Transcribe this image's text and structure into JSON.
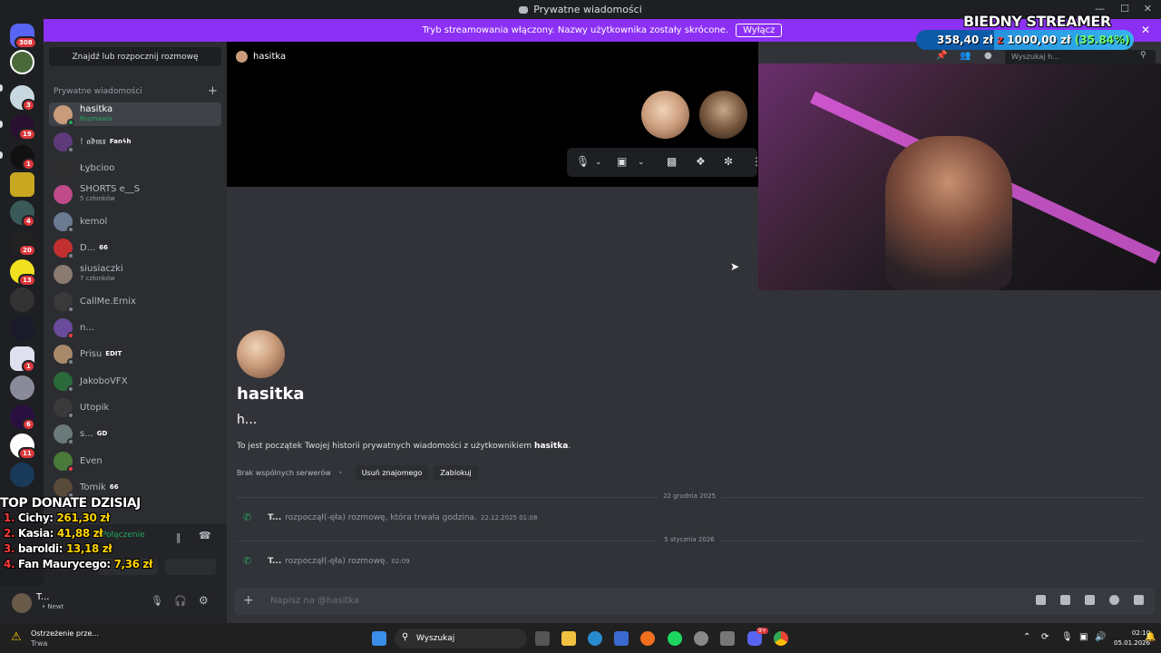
{
  "window": {
    "title": "Prywatne wiadomości"
  },
  "banner": {
    "text": "Tryb streamowania włączony. Nazwy użytkownika zostały skrócone.",
    "button": "Wyłącz"
  },
  "rail": {
    "badges": [
      "308",
      "3",
      "19",
      "1",
      "4",
      "20",
      "13",
      "1",
      "1",
      "6",
      "11"
    ]
  },
  "sidebar": {
    "find": "Znajdź lub rozpocznij rozmowę",
    "header": "Prywatne wiadomości",
    "dms": [
      {
        "name": "hasitka",
        "sub": "Rozmawia",
        "tag": "",
        "color": "#c99b7a",
        "status": "#23a55a"
      },
      {
        "name": "! 𝖆𝖉𝖒𝖝",
        "sub": "",
        "tag": "Fanϟh",
        "color": "#5e3a7a",
        "status": "#80848e"
      },
      {
        "name": "Łỵbcioo",
        "sub": "",
        "tag": "",
        "color": "#2d2d2d",
        "status": ""
      },
      {
        "name": "SHORTS e__S",
        "sub": "5 członków",
        "tag": "",
        "color": "#c04a8a",
        "status": ""
      },
      {
        "name": "kemol",
        "sub": "",
        "tag": "",
        "color": "#6a7a90",
        "status": "#80848e"
      },
      {
        "name": "D...",
        "sub": "",
        "tag": "66",
        "color": "#c23030",
        "status": "#80848e"
      },
      {
        "name": "siusiaczki",
        "sub": "7 członków",
        "tag": "",
        "color": "#8a7a70",
        "status": ""
      },
      {
        "name": "CallMe.Ernix",
        "sub": "",
        "tag": "",
        "color": "#3a3a3a",
        "status": "#80848e"
      },
      {
        "name": "n...",
        "sub": "",
        "tag": "",
        "color": "#6a4a9a",
        "status": "#f23f43"
      },
      {
        "name": "Prisu",
        "sub": "",
        "tag": "EDIT",
        "color": "#a88a6a",
        "status": "#80848e"
      },
      {
        "name": "JakoboVFX",
        "sub": "",
        "tag": "",
        "color": "#2a6a3a",
        "status": "#80848e"
      },
      {
        "name": "Utopik",
        "sub": "",
        "tag": "",
        "color": "#3a3a3a",
        "status": "#80848e"
      },
      {
        "name": "s...",
        "sub": "",
        "tag": "GD",
        "color": "#6a7a7a",
        "status": "#80848e"
      },
      {
        "name": "Even",
        "sub": "",
        "tag": "",
        "color": "#4a7a3a",
        "status": "#f23f43"
      },
      {
        "name": "Tomik",
        "sub": "",
        "tag": "66",
        "color": "#5a4a3a",
        "status": "#80848e"
      }
    ]
  },
  "voice": {
    "status": "Połączenie"
  },
  "user": {
    "name": "T...",
    "status": "• Newt"
  },
  "donate": {
    "title": "TOP DONATE DZISIAJ",
    "rows": [
      {
        "rank": "1.",
        "name": "Cichy:",
        "amount": "261,30 zł"
      },
      {
        "rank": "2.",
        "name": "Kasia:",
        "amount": "41,88 zł"
      },
      {
        "rank": "3.",
        "name": "baroldi:",
        "amount": "13,18 zł"
      },
      {
        "rank": "4.",
        "name": "Fan Maurycеgo:",
        "amount": "7,36 zł"
      }
    ]
  },
  "streamer": {
    "title": "BIEDNY STREAMER",
    "raised": "358,40 zł",
    "sep": "z",
    "goal": "1000,00 zł",
    "percent": "(35.84%)",
    "progress": 0.3584
  },
  "channel": {
    "name": "hasitka",
    "search_placeholder": "Wyszukaj h..."
  },
  "profile": {
    "name": "hasitka",
    "handle": "h...",
    "desc_prefix": "To jest początek Twojej historii prywatnych wiadomości z użytkownikiem",
    "desc_user": "hasitka",
    "desc_suffix": ".",
    "no_servers": "Brak wspólnych serwerów",
    "remove_friend": "Usuń znajomego",
    "block": "Zablokuj"
  },
  "messages": [
    {
      "date": "22 grudnia 2025",
      "who": "T...",
      "text": "rozpoczął(-ęła) rozmowę, która trwała godzina.",
      "time": "22.12.2025 01:08"
    },
    {
      "date": "5 stycznia 2026",
      "who": "T...",
      "text": "rozpoczął(-ęła) rozmowę.",
      "time": "02:09"
    }
  ],
  "composer": {
    "placeholder": "Napisz na @hasitka"
  },
  "taskbar": {
    "warn_title": "Ostrzeżenie prze...",
    "warn_sub": "Trwa",
    "search": "Wyszukaj",
    "time": "02:10",
    "date": "05.01.2026",
    "discord_badge": "9+"
  },
  "colors": {
    "accent": "#8c30f5",
    "online": "#23a55a",
    "badge": "#da373c"
  }
}
